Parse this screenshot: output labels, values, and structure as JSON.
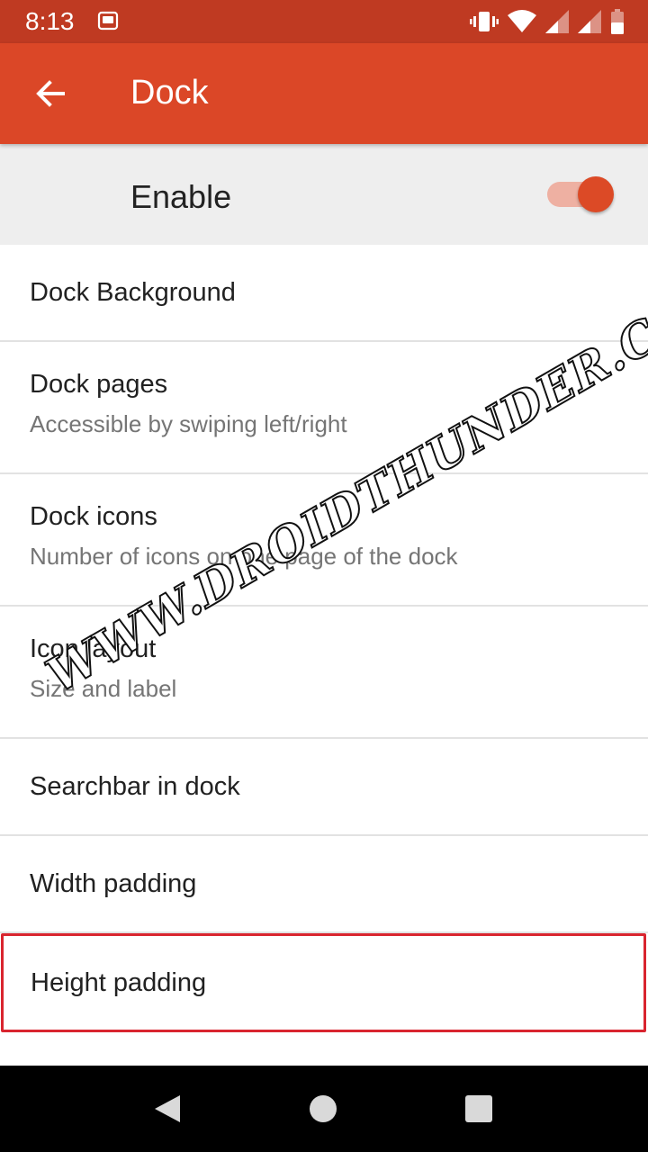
{
  "status_bar": {
    "time": "8:13",
    "notification_icon": "screenshot-icon",
    "icons": [
      "vibrate-icon",
      "wifi-icon",
      "signal-icon",
      "signal-icon",
      "battery-icon"
    ]
  },
  "app_bar": {
    "title": "Dock",
    "back_icon": "arrow-back-icon"
  },
  "enable": {
    "label": "Enable",
    "checked": true
  },
  "items": [
    {
      "title": "Dock Background",
      "subtitle": ""
    },
    {
      "title": "Dock pages",
      "subtitle": "Accessible by swiping left/right"
    },
    {
      "title": "Dock icons",
      "subtitle": "Number of icons on one page of the dock"
    },
    {
      "title": "Icon layout",
      "subtitle": "Size and label"
    },
    {
      "title": "Searchbar in dock",
      "subtitle": ""
    },
    {
      "title": "Width padding",
      "subtitle": ""
    },
    {
      "title": "Height padding",
      "subtitle": ""
    }
  ],
  "watermark": "WWW.DROIDTHUNDER.COM",
  "colors": {
    "status_bar": "#bf3a22",
    "app_bar": "#db4727",
    "accent": "#dc4a26",
    "highlight_border": "#d9252f"
  }
}
